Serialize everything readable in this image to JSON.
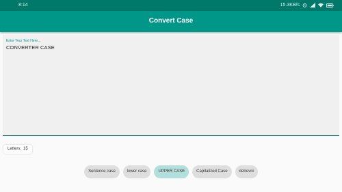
{
  "status_bar": {
    "time": "8:14",
    "network_speed": "15.3KB/s"
  },
  "app": {
    "title": "Convert Case"
  },
  "editor": {
    "hint": "Enter Your Text Here...",
    "value": "CONVERTER CASE"
  },
  "counter": {
    "label": "Letters:",
    "value": "15"
  },
  "buttons": {
    "sentence": "Sentence case",
    "lower": "lower case",
    "upper": "UPPER CASE",
    "capitalized": "Capitalized Case",
    "reverse": "detrevni"
  },
  "colors": {
    "primary": "#009688",
    "primary_dark": "#00796b",
    "active_button": "#b2dfdb",
    "button": "#dedede"
  }
}
